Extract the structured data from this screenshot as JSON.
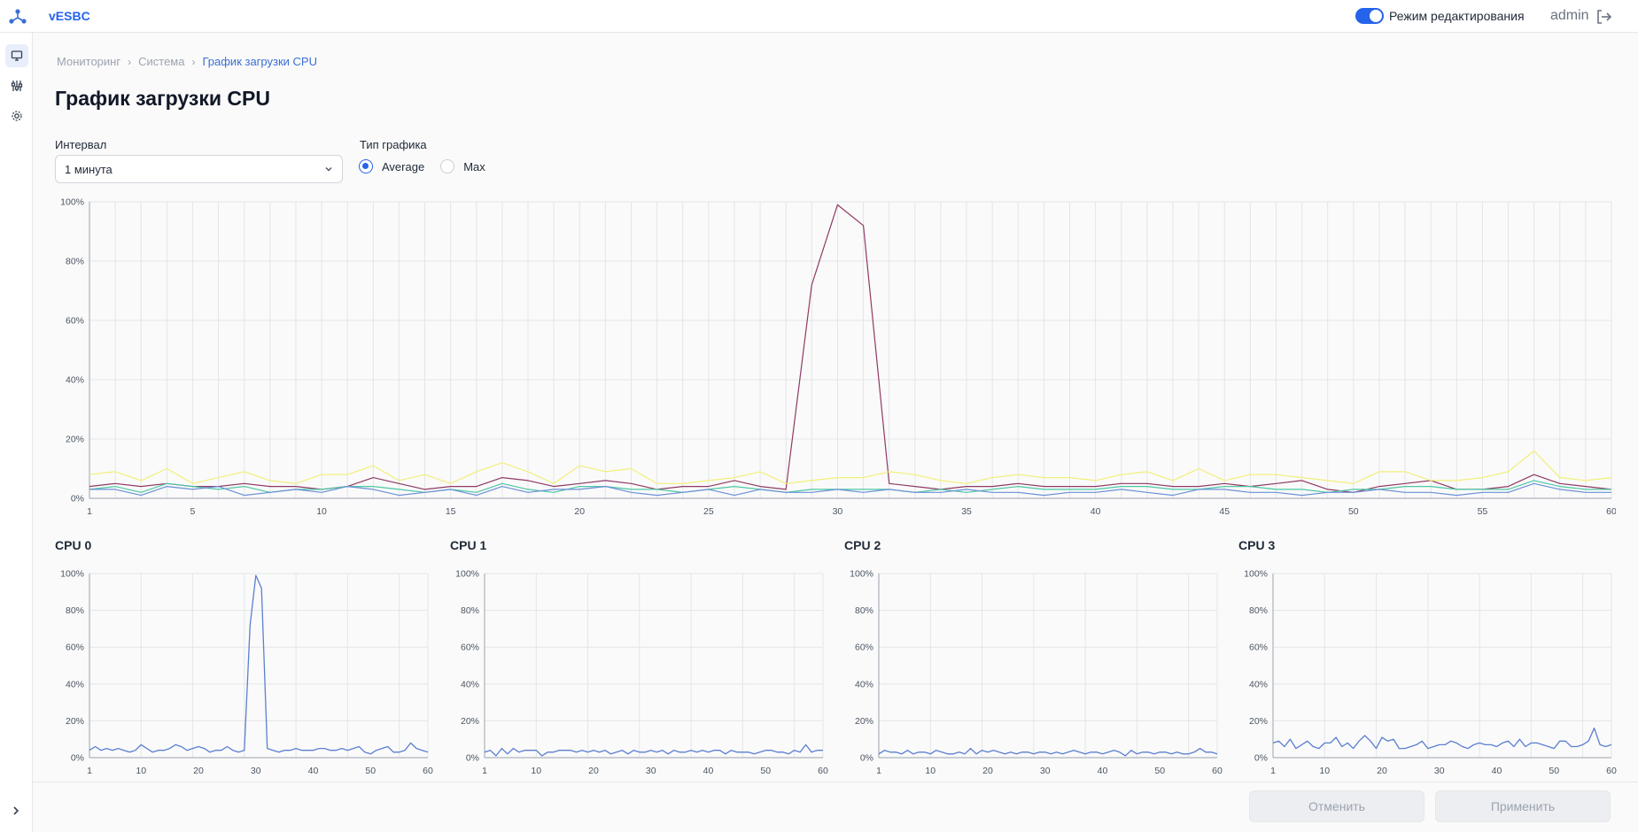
{
  "app": {
    "brand": "vESBC"
  },
  "header": {
    "edit_mode_label": "Режим редактирования",
    "edit_mode_on": true,
    "username": "admin"
  },
  "breadcrumb": [
    "Мониторинг",
    "Система",
    "График загрузки CPU"
  ],
  "page_title": "График загрузки CPU",
  "interval": {
    "label": "Интервал",
    "value": "1 минута"
  },
  "chart_type": {
    "label": "Тип графика",
    "options": [
      "Average",
      "Max"
    ],
    "selected": "Average"
  },
  "buttons": {
    "cancel": "Отменить",
    "apply": "Применить"
  },
  "colors": {
    "accent": "#2563eb",
    "cpu0": "#8e3a64",
    "cpu1": "#f2ef7a",
    "cpu2": "#4cc7a4",
    "cpu3": "#6b8fd6",
    "small_line": "#5b7fd0"
  },
  "chart_data": [
    {
      "type": "line",
      "x": [
        1,
        2,
        3,
        4,
        5,
        6,
        7,
        8,
        9,
        10,
        11,
        12,
        13,
        14,
        15,
        16,
        17,
        18,
        19,
        20,
        21,
        22,
        23,
        24,
        25,
        26,
        27,
        28,
        29,
        30,
        31,
        32,
        33,
        34,
        35,
        36,
        37,
        38,
        39,
        40,
        41,
        42,
        43,
        44,
        45,
        46,
        47,
        48,
        49,
        50,
        51,
        52,
        53,
        54,
        55,
        56,
        57,
        58,
        59,
        60
      ],
      "xticks": [
        1,
        5,
        10,
        15,
        20,
        25,
        30,
        35,
        40,
        45,
        50,
        55,
        60
      ],
      "yticks": [
        "0%",
        "20%",
        "40%",
        "60%",
        "80%",
        "100%"
      ],
      "ylim": [
        0,
        100
      ],
      "grid": true,
      "series": [
        {
          "values": [
            4,
            5,
            4,
            5,
            4,
            4,
            5,
            4,
            4,
            3,
            4,
            7,
            5,
            3,
            4,
            4,
            7,
            6,
            4,
            5,
            6,
            5,
            3,
            4,
            4,
            6,
            4,
            3,
            72,
            99,
            92,
            5,
            4,
            3,
            4,
            4,
            5,
            4,
            4,
            4,
            5,
            5,
            4,
            4,
            5,
            4,
            5,
            6,
            3,
            2,
            4,
            5,
            6,
            3,
            3,
            4,
            8,
            5,
            4,
            3
          ]
        },
        {
          "values": [
            8,
            9,
            6,
            10,
            5,
            7,
            9,
            6,
            5,
            8,
            8,
            11,
            6,
            8,
            5,
            9,
            12,
            9,
            5,
            11,
            9,
            10,
            5,
            5,
            6,
            7,
            9,
            5,
            6,
            7,
            7,
            9,
            8,
            6,
            5,
            7,
            8,
            7,
            7,
            6,
            8,
            9,
            6,
            10,
            6,
            8,
            8,
            7,
            6,
            5,
            9,
            9,
            6,
            6,
            7,
            9,
            16,
            7,
            6,
            7
          ]
        },
        {
          "values": [
            3,
            4,
            2,
            5,
            4,
            3,
            4,
            2,
            3,
            3,
            4,
            4,
            3,
            2,
            3,
            2,
            5,
            3,
            2,
            4,
            4,
            3,
            3,
            2,
            3,
            4,
            3,
            2,
            3,
            3,
            3,
            3,
            2,
            3,
            2,
            3,
            4,
            3,
            3,
            3,
            4,
            4,
            3,
            3,
            4,
            4,
            3,
            3,
            2,
            3,
            3,
            4,
            4,
            3,
            3,
            3,
            6,
            4,
            3,
            3
          ]
        },
        {
          "values": [
            3,
            3,
            1,
            4,
            3,
            4,
            1,
            2,
            3,
            2,
            4,
            3,
            1,
            2,
            3,
            1,
            4,
            2,
            3,
            3,
            4,
            2,
            1,
            2,
            3,
            1,
            3,
            2,
            2,
            3,
            2,
            3,
            2,
            2,
            3,
            2,
            2,
            1,
            2,
            2,
            3,
            2,
            1,
            3,
            3,
            2,
            2,
            1,
            2,
            2,
            3,
            2,
            2,
            1,
            2,
            2,
            5,
            3,
            2,
            2
          ]
        }
      ]
    },
    {
      "type": "line",
      "title": "CPU 0",
      "ylim": [
        0,
        100
      ],
      "grid": true,
      "xticks": [
        1,
        10,
        20,
        30,
        40,
        50,
        60
      ],
      "yticks": [
        "0%",
        "20%",
        "40%",
        "60%",
        "80%",
        "100%"
      ],
      "series": [
        {
          "values": [
            4,
            6,
            4,
            5,
            4,
            5,
            4,
            3,
            4,
            7,
            5,
            3,
            4,
            4,
            5,
            7,
            6,
            4,
            5,
            6,
            5,
            3,
            4,
            4,
            6,
            4,
            3,
            4,
            72,
            99,
            92,
            5,
            4,
            3,
            4,
            4,
            5,
            4,
            4,
            4,
            5,
            5,
            4,
            4,
            5,
            4,
            5,
            6,
            3,
            2,
            4,
            5,
            6,
            3,
            3,
            4,
            8,
            5,
            4,
            3
          ]
        }
      ]
    },
    {
      "type": "line",
      "title": "CPU 1",
      "ylim": [
        0,
        100
      ],
      "grid": true,
      "xticks": [
        1,
        10,
        20,
        30,
        40,
        50,
        60
      ],
      "yticks": [
        "0%",
        "20%",
        "40%",
        "60%",
        "80%",
        "100%"
      ],
      "series": [
        {
          "values": [
            3,
            4,
            1,
            5,
            2,
            5,
            3,
            4,
            4,
            4,
            1,
            3,
            3,
            4,
            4,
            4,
            3,
            4,
            3,
            4,
            3,
            4,
            2,
            3,
            4,
            2,
            4,
            3,
            3,
            4,
            3,
            4,
            2,
            4,
            3,
            3,
            4,
            3,
            4,
            3,
            4,
            4,
            2,
            4,
            3,
            3,
            3,
            2,
            3,
            4,
            4,
            3,
            3,
            2,
            4,
            3,
            7,
            3,
            4,
            4
          ]
        }
      ]
    },
    {
      "type": "line",
      "title": "CPU 2",
      "ylim": [
        0,
        100
      ],
      "grid": true,
      "xticks": [
        1,
        10,
        20,
        30,
        40,
        50,
        60
      ],
      "yticks": [
        "0%",
        "20%",
        "40%",
        "60%",
        "80%",
        "100%"
      ],
      "series": [
        {
          "values": [
            2,
            4,
            3,
            3,
            2,
            4,
            2,
            3,
            3,
            2,
            4,
            3,
            2,
            2,
            3,
            2,
            5,
            2,
            4,
            3,
            4,
            3,
            2,
            3,
            2,
            3,
            3,
            2,
            3,
            3,
            2,
            3,
            2,
            3,
            4,
            3,
            2,
            3,
            3,
            2,
            3,
            4,
            3,
            1,
            4,
            2,
            3,
            3,
            2,
            3,
            3,
            2,
            3,
            2,
            2,
            3,
            5,
            3,
            3,
            2
          ]
        }
      ]
    },
    {
      "type": "line",
      "title": "CPU 3",
      "ylim": [
        0,
        100
      ],
      "grid": true,
      "xticks": [
        1,
        10,
        20,
        30,
        40,
        50,
        60
      ],
      "yticks": [
        "0%",
        "20%",
        "40%",
        "60%",
        "80%",
        "100%"
      ],
      "series": [
        {
          "values": [
            8,
            9,
            6,
            10,
            5,
            7,
            9,
            6,
            5,
            8,
            8,
            11,
            6,
            8,
            5,
            9,
            12,
            9,
            5,
            11,
            9,
            10,
            5,
            5,
            6,
            7,
            9,
            5,
            6,
            7,
            7,
            9,
            8,
            6,
            5,
            7,
            8,
            7,
            7,
            6,
            8,
            9,
            6,
            10,
            6,
            8,
            8,
            7,
            6,
            5,
            9,
            9,
            6,
            6,
            7,
            9,
            16,
            7,
            6,
            7
          ]
        }
      ]
    }
  ]
}
